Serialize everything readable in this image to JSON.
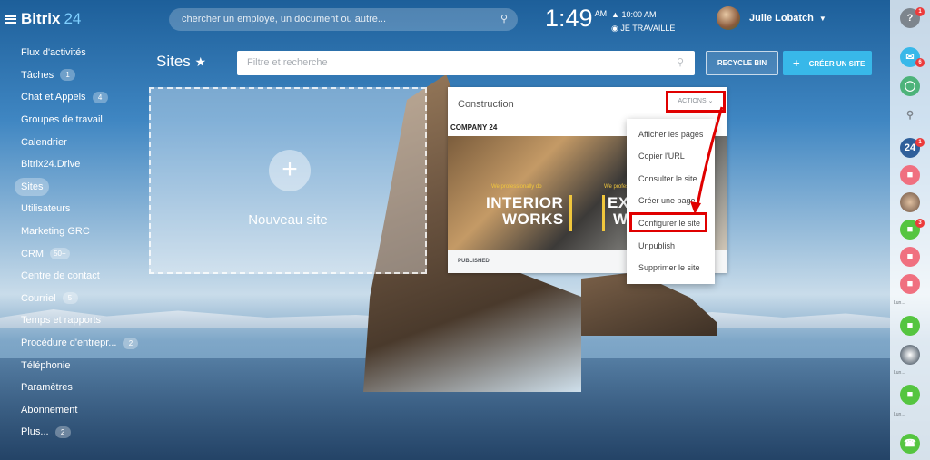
{
  "header": {
    "logo_main": "Bitrix",
    "logo_24": "24",
    "search_placeholder": "chercher un employé, un document ou autre...",
    "time": "1:49",
    "ampm": "AM",
    "alarm_time": "10:00 AM",
    "work_status": "JE TRAVAILLE",
    "user_name": "Julie Lobatch"
  },
  "sidebar": {
    "items": [
      {
        "label": "Flux d'activités"
      },
      {
        "label": "Tâches",
        "badge": "1"
      },
      {
        "label": "Chat et Appels",
        "badge": "4"
      },
      {
        "label": "Groupes de travail"
      },
      {
        "label": "Calendrier"
      },
      {
        "label": "Bitrix24.Drive"
      },
      {
        "label": "Sites",
        "active": true
      },
      {
        "label": "Utilisateurs"
      },
      {
        "label": "Marketing GRC"
      },
      {
        "label": "CRM",
        "badge": "50+"
      },
      {
        "label": "Centre de contact"
      },
      {
        "label": "Courriel",
        "badge": "5"
      },
      {
        "label": "Temps et rapports"
      },
      {
        "label": "Procédure d'entrepr...",
        "badge": "2"
      },
      {
        "label": "Téléphonie"
      },
      {
        "label": "Paramètres"
      },
      {
        "label": "Abonnement"
      },
      {
        "label": "Plus...",
        "badge": "2"
      }
    ]
  },
  "main": {
    "title": "Sites",
    "filter_placeholder": "Filtre et recherche",
    "recycle_label": "RECYCLE BIN",
    "create_label": "CRÉER UN SITE",
    "new_site_label": "Nouveau site",
    "site_card": {
      "name": "Construction",
      "actions_label": "ACTIONS",
      "status": "PUBLISHED",
      "preview_brand": "COMPANY 24",
      "preview_tag_1": "We professionally do",
      "preview_line_1": "INTERIOR",
      "preview_line_2": "WORKS",
      "preview_tag_2": "We professionally do",
      "preview_line_3": "EX",
      "preview_line_4": "W"
    },
    "actions_menu": [
      "Afficher les pages",
      "Copier l'URL",
      "Consulter le site",
      "Créer une page",
      "Configurer le site",
      "Unpublish",
      "Supprimer le site"
    ],
    "highlighted_item": "Configurer le site"
  },
  "right_panel": {
    "help_badge": "1",
    "notif_badge": "6",
    "app_badge": "1",
    "chat_badge": "3",
    "labels": [
      "Lun...",
      "Lun...",
      "Lun..."
    ]
  },
  "colors": {
    "accent": "#38b8e9",
    "highlight": "#e00000",
    "green": "#55c540",
    "pink": "#f07080"
  }
}
